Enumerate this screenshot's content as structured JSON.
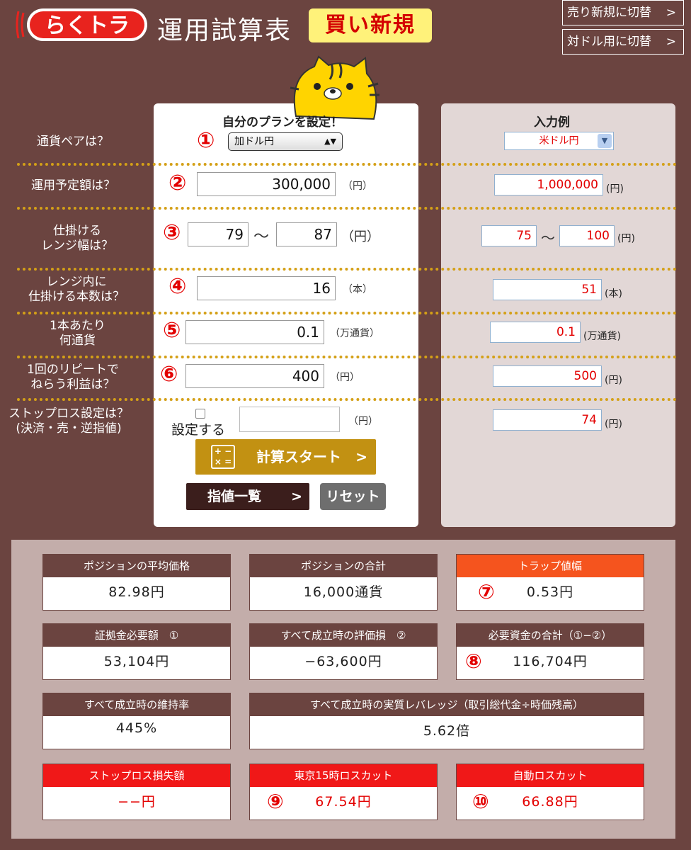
{
  "header": {
    "logo_text": "らくトラ",
    "title": "運用試算表",
    "mode_badge": "買い新規",
    "switch_sell": "売り新規に切替",
    "switch_usd": "対ドル用に切替",
    "arrow": ">"
  },
  "plan": {
    "heading": "自分のプランを設定！",
    "currency_pair": "加ドル円",
    "amount": "300,000",
    "range_low": "79",
    "range_high": "87",
    "count": "16",
    "lot": "0.1",
    "profit": "400",
    "stop_label": "設定する",
    "calc_button": "計算スタート",
    "list_button": "指値一覧",
    "reset_button": "リセット"
  },
  "example": {
    "heading": "入力例",
    "currency_pair": "米ドル円",
    "amount": "1,000,000",
    "range_low": "75",
    "range_high": "100",
    "count": "51",
    "lot": "0.1",
    "profit": "500",
    "stop": "74"
  },
  "questions": {
    "q1": "通貨ペアは？",
    "q2": "運用予定額は？",
    "q3a": "仕掛ける",
    "q3b": "レンジ幅は？",
    "q4a": "レンジ内に",
    "q4b": "仕掛ける本数は？",
    "q5a": "1本あたり",
    "q5b": "何通貨",
    "q6a": "1回のリピートで",
    "q6b": "ねらう利益は？",
    "q7a": "ストップロス設定は？",
    "q7b": "(決済・売・逆指値)"
  },
  "units": {
    "yen": "（円）",
    "hon": "（本）",
    "man": "（万通貨）",
    "yen_s": "(円)",
    "hon_s": "(本)",
    "man_s": "(万通貨)",
    "tilde": "〜"
  },
  "numbers": {
    "n1": "①",
    "n2": "②",
    "n3": "③",
    "n4": "④",
    "n5": "⑤",
    "n6": "⑥",
    "n7": "⑦",
    "n8": "⑧",
    "n9": "⑨",
    "n10": "⑩"
  },
  "results": {
    "avg_price_label": "ポジションの平均価格",
    "avg_price": "82.98円",
    "total_pos_label": "ポジションの合計",
    "total_pos": "16,000通貨",
    "trap_label": "トラップ値幅",
    "trap": "0.53円",
    "margin_label": "証拠金必要額　①",
    "margin": "53,104円",
    "eval_loss_label": "すべて成立時の評価損　②",
    "eval_loss": "−63,600円",
    "required_label": "必要資金の合計（①−②）",
    "required": "116,704円",
    "maint_label": "すべて成立時の維持率",
    "maint": "445%",
    "leverage_label": "すべて成立時の実質レバレッジ（取引総代金÷時価残高）",
    "leverage": "5.62倍",
    "stoploss_label": "ストップロス損失額",
    "stoploss": "−−円",
    "tokyo_label": "東京15時ロスカット",
    "tokyo": "67.54円",
    "auto_label": "自動ロスカット",
    "auto": "66.88円"
  },
  "colors": {
    "background": "#6b4440",
    "accent_gold": "#c29112",
    "alert_red": "#e30000",
    "badge_yellow": "#fff27a"
  }
}
